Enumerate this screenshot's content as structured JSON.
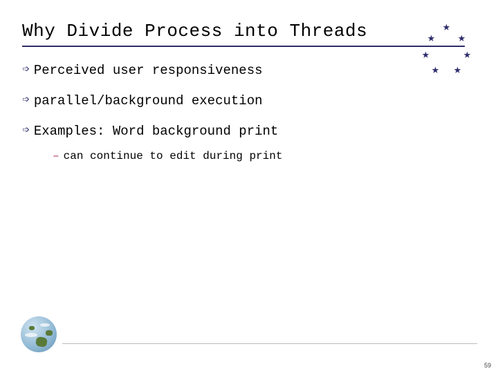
{
  "title": "Why Divide Process into Threads",
  "bullets": [
    {
      "text": "Perceived user responsiveness"
    },
    {
      "text": "parallel/background execution"
    },
    {
      "text": "Examples: Word background print"
    }
  ],
  "sub_bullet": "can continue to edit during print",
  "page_number": "59"
}
